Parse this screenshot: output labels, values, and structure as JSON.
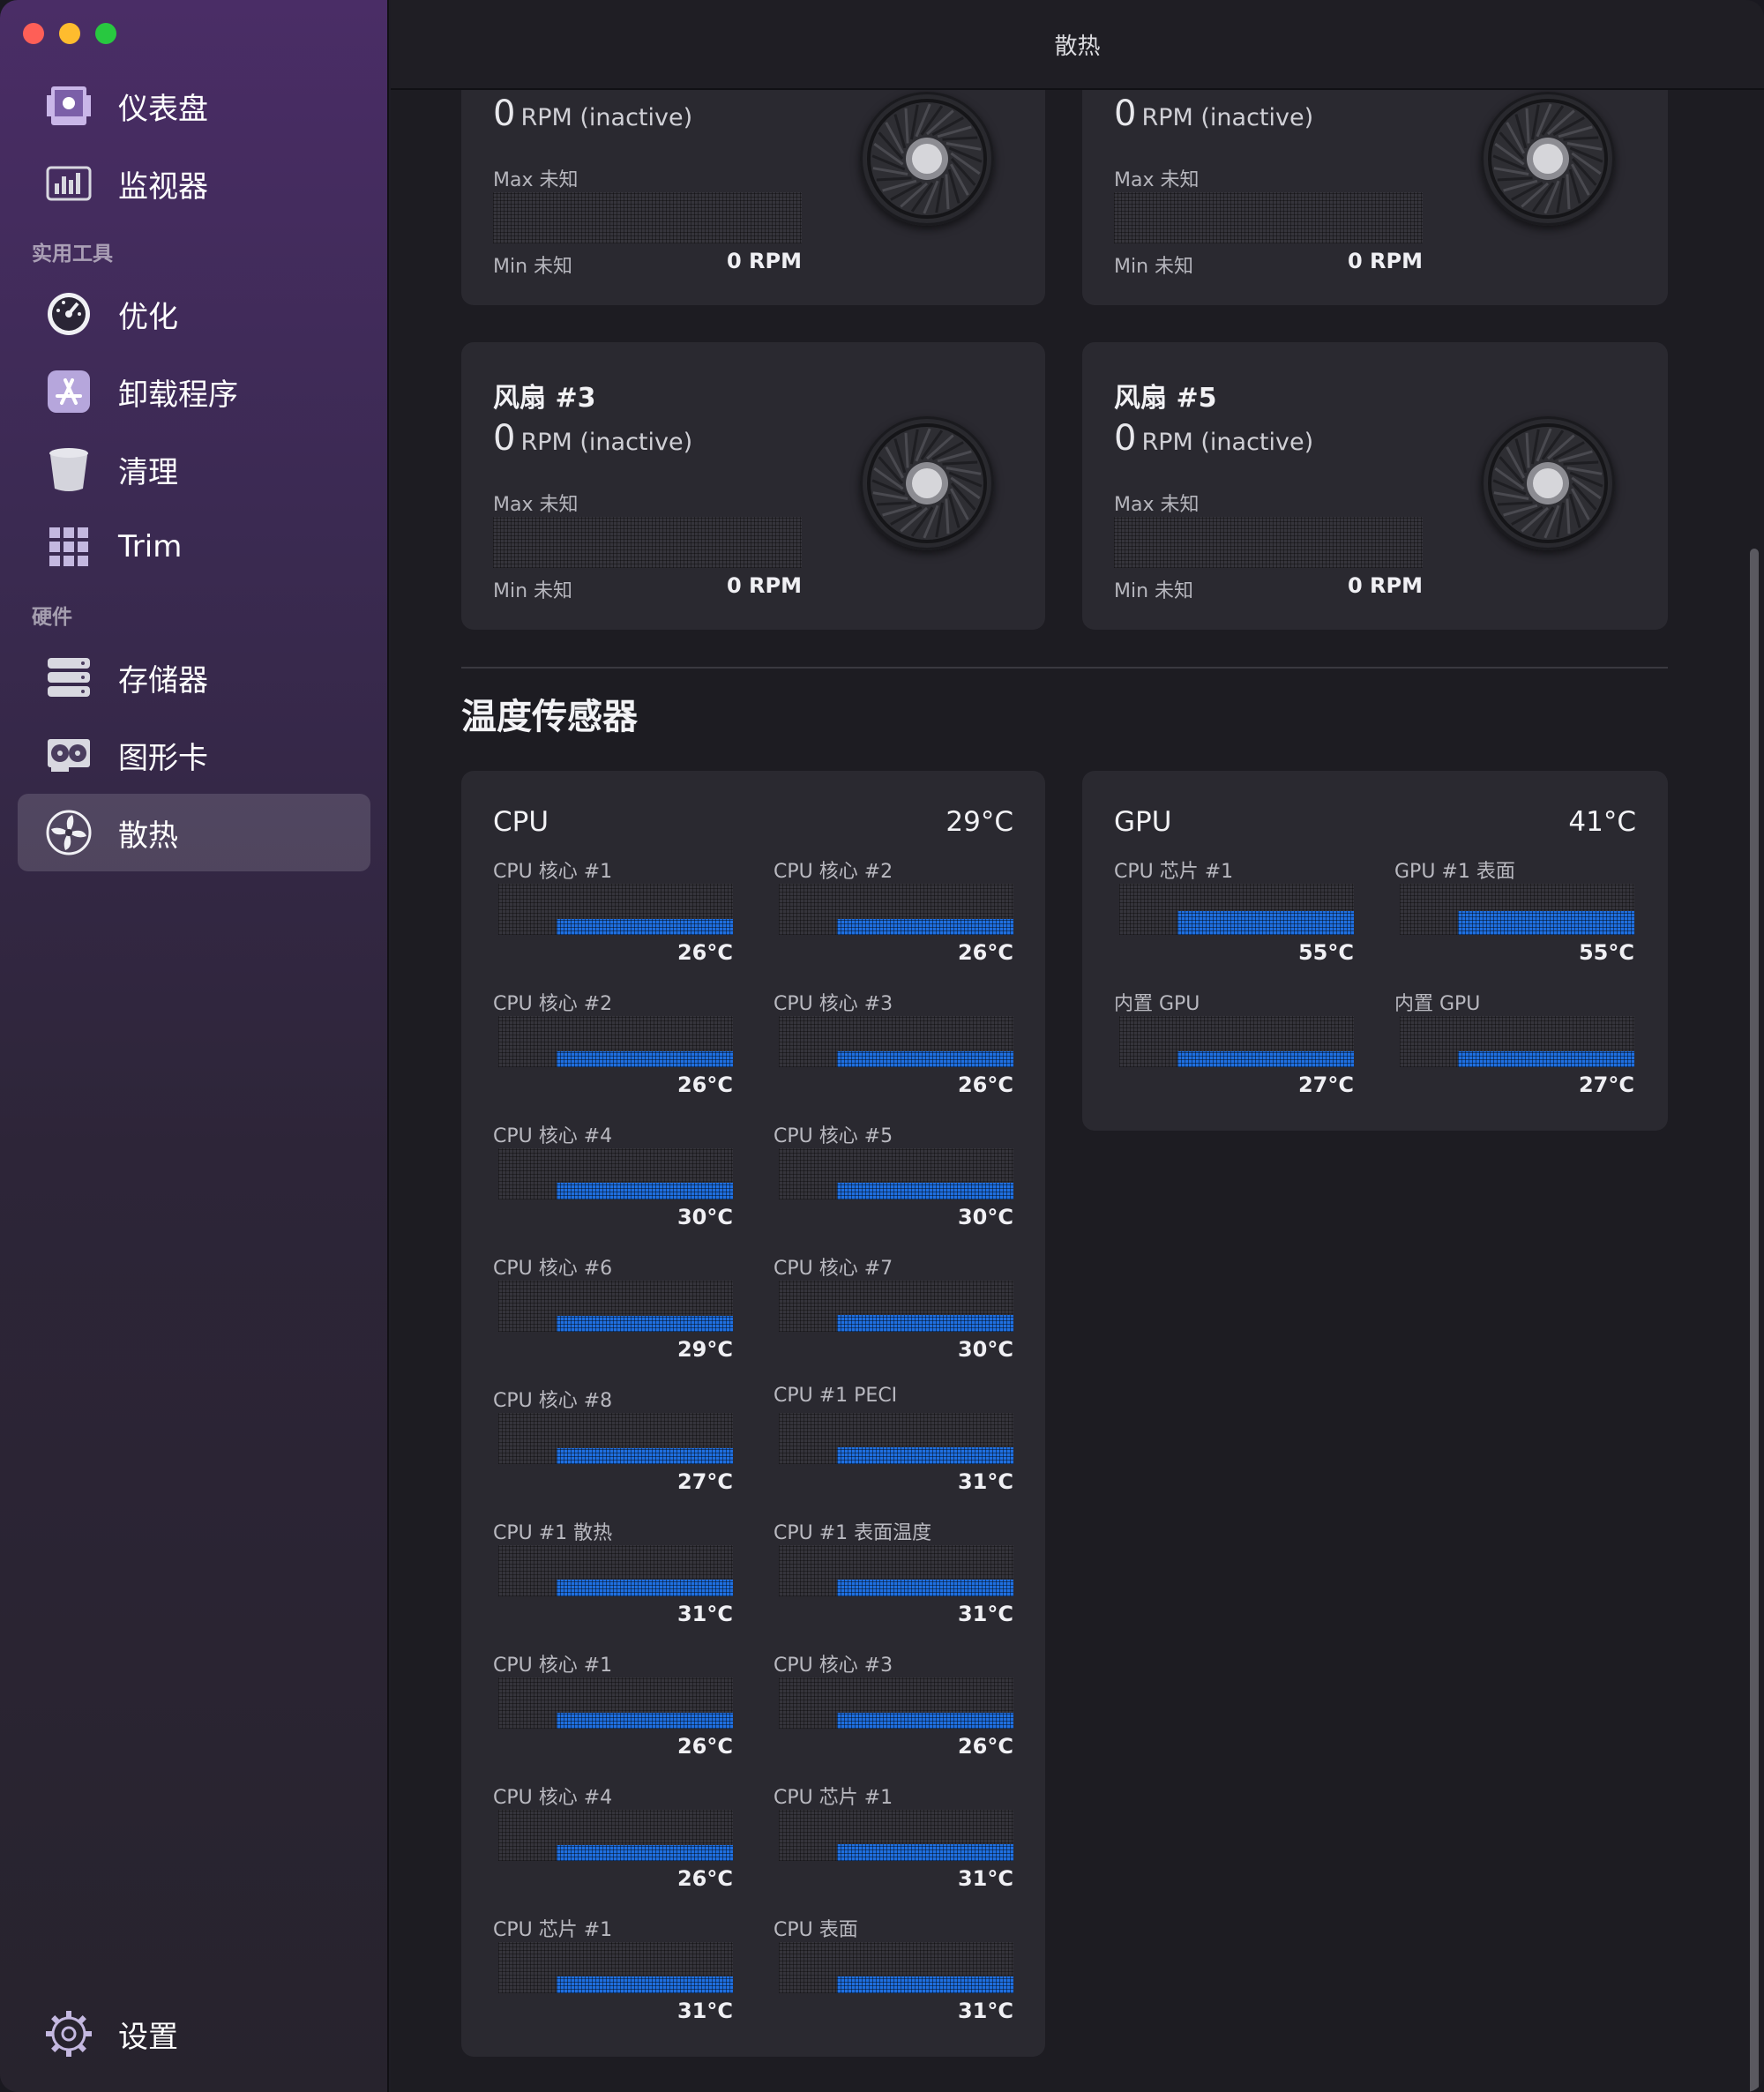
{
  "window": {
    "title": "散热"
  },
  "sidebar": {
    "items_top": [
      {
        "label": "仪表盘",
        "icon": "dashboard-icon"
      },
      {
        "label": "监视器",
        "icon": "monitor-icon"
      }
    ],
    "section_utilities": "实用工具",
    "items_utilities": [
      {
        "label": "优化",
        "icon": "speedometer-icon"
      },
      {
        "label": "卸载程序",
        "icon": "app-store-icon"
      },
      {
        "label": "清理",
        "icon": "trash-icon"
      },
      {
        "label": "Trim",
        "icon": "grid-icon"
      }
    ],
    "section_hardware": "硬件",
    "items_hardware": [
      {
        "label": "存储器",
        "icon": "storage-icon"
      },
      {
        "label": "图形卡",
        "icon": "graphics-card-icon"
      },
      {
        "label": "散热",
        "icon": "fan-icon",
        "active": true
      }
    ],
    "settings": {
      "label": "设置",
      "icon": "gear-icon"
    }
  },
  "fans": [
    {
      "title": "",
      "rpm": "0",
      "rpm_unit": "RPM (inactive)",
      "max_label": "Max 未知",
      "min_label": "Min 未知",
      "min_value": "0 RPM"
    },
    {
      "title": "",
      "rpm": "0",
      "rpm_unit": "RPM (inactive)",
      "max_label": "Max 未知",
      "min_label": "Min 未知",
      "min_value": "0 RPM"
    },
    {
      "title": "风扇 #3",
      "rpm": "0",
      "rpm_unit": "RPM (inactive)",
      "max_label": "Max 未知",
      "min_label": "Min 未知",
      "min_value": "0 RPM"
    },
    {
      "title": "风扇 #5",
      "rpm": "0",
      "rpm_unit": "RPM (inactive)",
      "max_label": "Max 未知",
      "min_label": "Min 未知",
      "min_value": "0 RPM"
    }
  ],
  "temperature_section": {
    "title": "温度传感器"
  },
  "cpu_card": {
    "title": "CPU",
    "value": "29°C",
    "sensors": [
      {
        "name": "CPU 核心 #1",
        "value": "26°C",
        "level": 0.25
      },
      {
        "name": "CPU 核心 #2",
        "value": "26°C",
        "level": 0.25
      },
      {
        "name": "CPU 核心 #2",
        "value": "26°C",
        "level": 0.25
      },
      {
        "name": "CPU 核心 #3",
        "value": "26°C",
        "level": 0.25
      },
      {
        "name": "CPU 核心 #4",
        "value": "30°C",
        "level": 0.3
      },
      {
        "name": "CPU 核心 #5",
        "value": "30°C",
        "level": 0.3
      },
      {
        "name": "CPU 核心 #6",
        "value": "29°C",
        "level": 0.28
      },
      {
        "name": "CPU 核心 #7",
        "value": "30°C",
        "level": 0.3
      },
      {
        "name": "CPU 核心 #8",
        "value": "27°C",
        "level": 0.26
      },
      {
        "name": "CPU #1 PECI",
        "value": "31°C",
        "level": 0.3
      },
      {
        "name": "CPU #1 散热",
        "value": "31°C",
        "level": 0.3
      },
      {
        "name": "CPU #1 表面温度",
        "value": "31°C",
        "level": 0.3
      },
      {
        "name": "CPU 核心 #1",
        "value": "26°C",
        "level": 0.25
      },
      {
        "name": "CPU 核心 #3",
        "value": "26°C",
        "level": 0.25
      },
      {
        "name": "CPU 核心 #4",
        "value": "26°C",
        "level": 0.25
      },
      {
        "name": "CPU 芯片 #1",
        "value": "31°C",
        "level": 0.3
      },
      {
        "name": "CPU 芯片 #1",
        "value": "31°C",
        "level": 0.3
      },
      {
        "name": "CPU 表面",
        "value": "31°C",
        "level": 0.3
      }
    ]
  },
  "gpu_card": {
    "title": "GPU",
    "value": "41°C",
    "sensors": [
      {
        "name": "CPU 芯片 #1",
        "value": "55°C",
        "level": 0.55
      },
      {
        "name": "GPU #1 表面",
        "value": "55°C",
        "level": 0.55
      },
      {
        "name": "内置 GPU",
        "value": "27°C",
        "level": 0.26
      },
      {
        "name": "内置 GPU",
        "value": "27°C",
        "level": 0.26
      }
    ]
  },
  "colors": {
    "accent": "#1f6fe0",
    "sidebar_top": "#4a2d66",
    "card": "#2a2930"
  }
}
